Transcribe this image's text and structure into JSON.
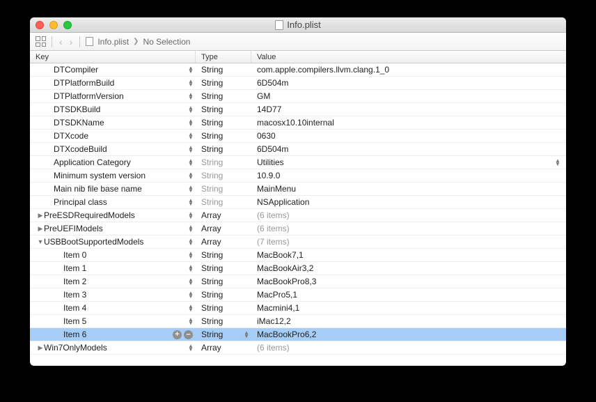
{
  "window": {
    "title": "Info.plist"
  },
  "breadcrumb": {
    "file": "Info.plist",
    "selection": "No Selection"
  },
  "columns": {
    "key": "Key",
    "type": "Type",
    "value": "Value"
  },
  "rows": [
    {
      "key": "DTCompiler",
      "type": "String",
      "value": "com.apple.compilers.llvm.clang.1_0",
      "indent": 1,
      "disclosure": "",
      "typeDimmed": false
    },
    {
      "key": "DTPlatformBuild",
      "type": "String",
      "value": "6D504m",
      "indent": 1,
      "disclosure": "",
      "typeDimmed": false
    },
    {
      "key": "DTPlatformVersion",
      "type": "String",
      "value": "GM",
      "indent": 1,
      "disclosure": "",
      "typeDimmed": false
    },
    {
      "key": "DTSDKBuild",
      "type": "String",
      "value": "14D77",
      "indent": 1,
      "disclosure": "",
      "typeDimmed": false
    },
    {
      "key": "DTSDKName",
      "type": "String",
      "value": "macosx10.10internal",
      "indent": 1,
      "disclosure": "",
      "typeDimmed": false
    },
    {
      "key": "DTXcode",
      "type": "String",
      "value": "0630",
      "indent": 1,
      "disclosure": "",
      "typeDimmed": false
    },
    {
      "key": "DTXcodeBuild",
      "type": "String",
      "value": "6D504m",
      "indent": 1,
      "disclosure": "",
      "typeDimmed": false
    },
    {
      "key": "Application Category",
      "type": "String",
      "value": "Utilities",
      "indent": 1,
      "disclosure": "",
      "typeDimmed": true,
      "valueStepper": true
    },
    {
      "key": "Minimum system version",
      "type": "String",
      "value": "10.9.0",
      "indent": 1,
      "disclosure": "",
      "typeDimmed": true
    },
    {
      "key": "Main nib file base name",
      "type": "String",
      "value": "MainMenu",
      "indent": 1,
      "disclosure": "",
      "typeDimmed": true
    },
    {
      "key": "Principal class",
      "type": "String",
      "value": "NSApplication",
      "indent": 1,
      "disclosure": "",
      "typeDimmed": true
    },
    {
      "key": "PreESDRequiredModels",
      "type": "Array",
      "value": "(6 items)",
      "indent": 0,
      "disclosure": "right",
      "typeDimmed": false,
      "valueDimmed": true
    },
    {
      "key": "PreUEFIModels",
      "type": "Array",
      "value": "(6 items)",
      "indent": 0,
      "disclosure": "right",
      "typeDimmed": false,
      "valueDimmed": true
    },
    {
      "key": "USBBootSupportedModels",
      "type": "Array",
      "value": "(7 items)",
      "indent": 0,
      "disclosure": "down",
      "typeDimmed": false,
      "valueDimmed": true
    },
    {
      "key": "Item 0",
      "type": "String",
      "value": "MacBook7,1",
      "indent": 2,
      "disclosure": "",
      "typeDimmed": false
    },
    {
      "key": "Item 1",
      "type": "String",
      "value": "MacBookAir3,2",
      "indent": 2,
      "disclosure": "",
      "typeDimmed": false
    },
    {
      "key": "Item 2",
      "type": "String",
      "value": "MacBookPro8,3",
      "indent": 2,
      "disclosure": "",
      "typeDimmed": false
    },
    {
      "key": "Item 3",
      "type": "String",
      "value": "MacPro5,1",
      "indent": 2,
      "disclosure": "",
      "typeDimmed": false
    },
    {
      "key": "Item 4",
      "type": "String",
      "value": "Macmini4,1",
      "indent": 2,
      "disclosure": "",
      "typeDimmed": false
    },
    {
      "key": "Item 5",
      "type": "String",
      "value": "iMac12,2",
      "indent": 2,
      "disclosure": "",
      "typeDimmed": false
    },
    {
      "key": "Item 6",
      "type": "String",
      "value": "MacBookPro6,2",
      "indent": 2,
      "disclosure": "",
      "typeDimmed": false,
      "selected": true,
      "addrem": true,
      "typeStepper": true
    },
    {
      "key": "Win7OnlyModels",
      "type": "Array",
      "value": "(6 items)",
      "indent": 0,
      "disclosure": "right",
      "typeDimmed": false,
      "valueDimmed": true
    }
  ]
}
